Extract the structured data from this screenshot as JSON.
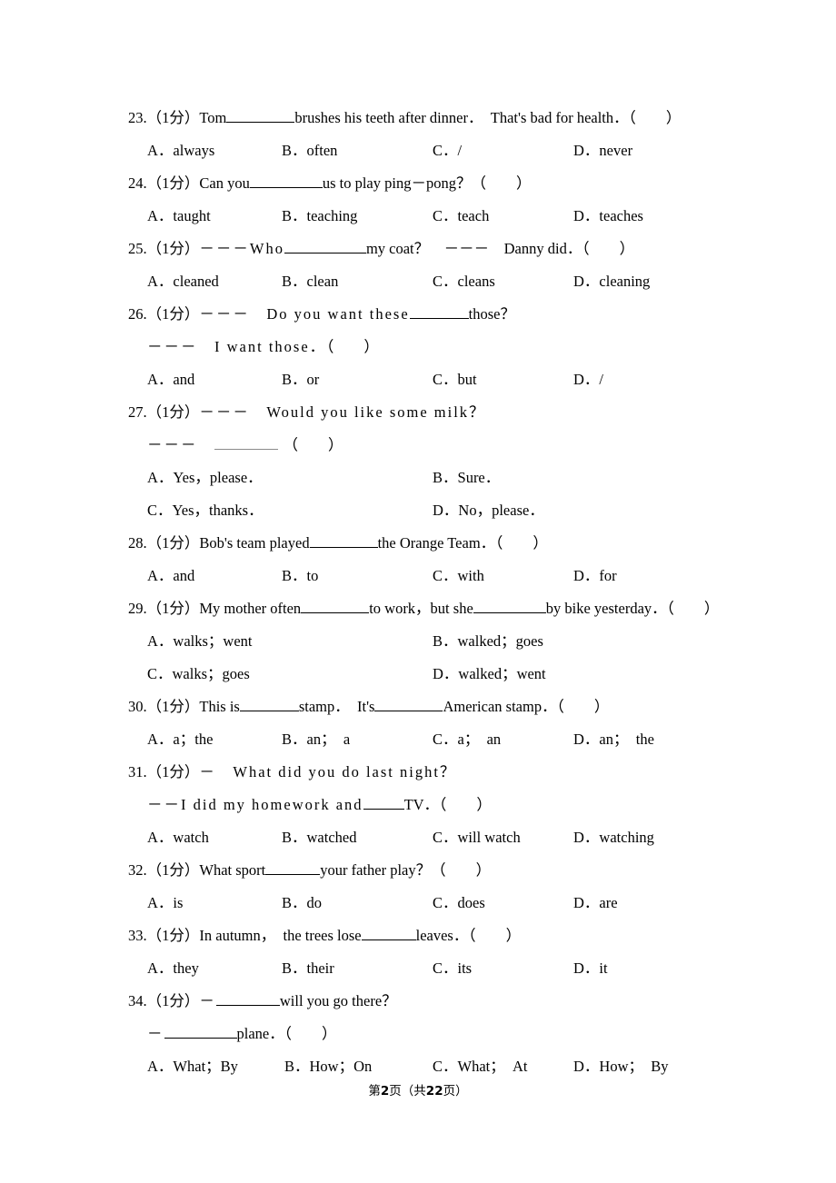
{
  "document": {
    "type": "exam-paper",
    "language": "zh-CN/en",
    "score_tag_prefix": "（1",
    "score_tag_unit": "分",
    "score_tag_suffix": "）"
  },
  "footer": {
    "prefix": "第",
    "page_number": "2",
    "middle": "页（共",
    "total_pages": "22",
    "suffix": "页）"
  },
  "questions": [
    {
      "number": "23.",
      "score": "（1分）",
      "lines": [
        {
          "segments": [
            "Tom",
            "__blank70__",
            "brushes his teeth after dinner．　That's bad for health．（　　）"
          ]
        }
      ],
      "stem_pre": "Tom",
      "stem_post": "brushes his teeth after dinner．　That's bad for health．",
      "paren": "（　　）",
      "options_layout": "four",
      "options": [
        {
          "label": "A．",
          "text": "always"
        },
        {
          "label": "B．",
          "text": "often"
        },
        {
          "label": "C．",
          "text": "/"
        },
        {
          "label": "D．",
          "text": "never"
        }
      ]
    },
    {
      "number": "24.",
      "score": "（1分）",
      "stem_pre": "Can you",
      "stem_post": "us to play ping－pong？",
      "paren": "（　　）",
      "options_layout": "four",
      "options": [
        {
          "label": "A．",
          "text": "taught"
        },
        {
          "label": "B．",
          "text": "teaching"
        },
        {
          "label": "C．",
          "text": "teach"
        },
        {
          "label": "D．",
          "text": "teaches"
        }
      ]
    },
    {
      "number": "25.",
      "score": "（1分）",
      "stem_pre": "－－－Who",
      "stem_post": "my coat？　－－－　Danny did．",
      "paren": "（　　）",
      "options_layout": "four",
      "options": [
        {
          "label": "A．",
          "text": "cleaned"
        },
        {
          "label": "B．",
          "text": "clean"
        },
        {
          "label": "C．",
          "text": "cleans"
        },
        {
          "label": "D．",
          "text": "cleaning"
        }
      ]
    },
    {
      "number": "26.",
      "score": "（1分）",
      "stem_pre": "－－－　Do you want these",
      "stem_post": "those？",
      "stem_line2": "－－－　I want those．",
      "paren": "（　　）",
      "options_layout": "four",
      "options": [
        {
          "label": "A．",
          "text": "and"
        },
        {
          "label": "B．",
          "text": "or"
        },
        {
          "label": "C．",
          "text": "but"
        },
        {
          "label": "D．",
          "text": "/"
        }
      ]
    },
    {
      "number": "27.",
      "score": "（1分）",
      "stem_pre": "－－－　Would you like some milk？",
      "stem_line2_pre": "－－－",
      "paren": "（　　）",
      "options_layout": "two",
      "options": [
        {
          "label": "A．",
          "text": "Yes，please．"
        },
        {
          "label": "B．",
          "text": "Sure．"
        },
        {
          "label": "C．",
          "text": "Yes，thanks．"
        },
        {
          "label": "D．",
          "text": "No，please．"
        }
      ]
    },
    {
      "number": "28.",
      "score": "（1分）",
      "stem_pre": "Bob's team played",
      "stem_post": "the Orange Team．",
      "paren": "（　　）",
      "options_layout": "four",
      "options": [
        {
          "label": "A．",
          "text": "and"
        },
        {
          "label": "B．",
          "text": "to"
        },
        {
          "label": "C．",
          "text": "with"
        },
        {
          "label": "D．",
          "text": "for"
        }
      ]
    },
    {
      "number": "29.",
      "score": "（1分）",
      "stem_pre": "My mother often",
      "stem_mid": "to work，but she",
      "stem_post": "by bike yesterday．",
      "paren": "（　　）",
      "options_layout": "two",
      "options": [
        {
          "label": "A．",
          "text": "walks；went"
        },
        {
          "label": "B．",
          "text": "walked；goes"
        },
        {
          "label": "C．",
          "text": "walks；goes"
        },
        {
          "label": "D．",
          "text": "walked；went"
        }
      ]
    },
    {
      "number": "30.",
      "score": "（1分）",
      "stem_pre": "This is",
      "stem_mid": "stamp．　It's",
      "stem_post": "American stamp．",
      "paren": "（　　）",
      "options_layout": "four",
      "options": [
        {
          "label": "A．",
          "text": "a；the"
        },
        {
          "label": "B．",
          "text": "an；　a"
        },
        {
          "label": "C．",
          "text": "a；　an"
        },
        {
          "label": "D．",
          "text": "an；　the"
        }
      ]
    },
    {
      "number": "31.",
      "score": "（1分）",
      "stem_pre": "－　What did you do last night？",
      "stem_line2_pre": "－－I did my homework and",
      "stem_line2_post": "TV．",
      "paren": "（　　）",
      "options_layout": "four",
      "options": [
        {
          "label": "A．",
          "text": "watch"
        },
        {
          "label": "B．",
          "text": "watched"
        },
        {
          "label": "C．",
          "text": "will watch"
        },
        {
          "label": "D．",
          "text": "watching"
        }
      ]
    },
    {
      "number": "32.",
      "score": "（1分）",
      "stem_pre": "What sport",
      "stem_post": "your father play？",
      "paren": "（　　）",
      "options_layout": "four",
      "options": [
        {
          "label": "A．",
          "text": "is"
        },
        {
          "label": "B．",
          "text": "do"
        },
        {
          "label": "C．",
          "text": "does"
        },
        {
          "label": "D．",
          "text": "are"
        }
      ]
    },
    {
      "number": "33.",
      "score": "（1分）",
      "stem_pre": "In autumn，　the trees lose",
      "stem_post": "leaves．",
      "paren": "（　　）",
      "options_layout": "four",
      "options": [
        {
          "label": "A．",
          "text": "they"
        },
        {
          "label": "B．",
          "text": "their"
        },
        {
          "label": "C．",
          "text": "its"
        },
        {
          "label": "D．",
          "text": "it"
        }
      ]
    },
    {
      "number": "34.",
      "score": "（1分）",
      "stem_pre": "－",
      "stem_post": "will you go there？",
      "stem_line2_pre": "－",
      "stem_line2_post": "plane．",
      "paren": "（　　）",
      "options_layout": "four-wide",
      "options": [
        {
          "label": "A．",
          "text": "What；By"
        },
        {
          "label": "B．",
          "text": "How；On"
        },
        {
          "label": "C．",
          "text": "What；　At"
        },
        {
          "label": "D．",
          "text": "How；　By"
        }
      ]
    }
  ]
}
